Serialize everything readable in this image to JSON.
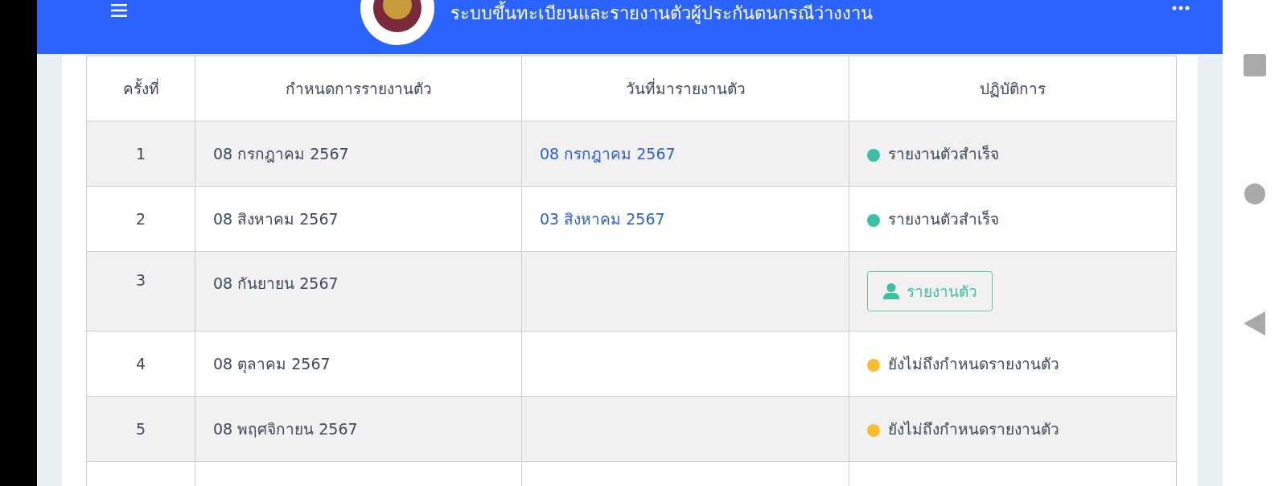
{
  "header": {
    "title": "ระบบขึ้นทะเบียนและรายงานตัวผู้ประกันตนกรณีว่างงาน"
  },
  "table": {
    "columns": [
      "ครั้งที่",
      "กำหนดการรายงานตัว",
      "วันที่มารายงานตัว",
      "ปฏิบัติการ"
    ],
    "rows": [
      {
        "number": "1",
        "due_date": "08 กรกฎาคม 2567",
        "report_date": "08 กรกฎาคม 2567",
        "action": {
          "kind": "status",
          "label": "รายงานตัวสำเร็จ",
          "color": "#3cbfa3"
        }
      },
      {
        "number": "2",
        "due_date": "08 สิงหาคม 2567",
        "report_date": "03 สิงหาคม 2567",
        "action": {
          "kind": "status",
          "label": "รายงานตัวสำเร็จ",
          "color": "#3cbfa3"
        }
      },
      {
        "number": "3",
        "due_date": "08 กันยายน 2567",
        "action": {
          "kind": "button",
          "label": "รายงานตัว"
        }
      },
      {
        "number": "4",
        "due_date": "08 ตุลาคม 2567",
        "action": {
          "kind": "status",
          "label": "ยังไม่ถึงกำหนดรายงานตัว",
          "color": "#fbbd2e"
        }
      },
      {
        "number": "5",
        "due_date": "08 พฤศจิกายน 2567",
        "action": {
          "kind": "status",
          "label": "ยังไม่ถึงกำหนดรายงานตัว",
          "color": "#fbbd2e"
        }
      },
      {
        "number": "",
        "due_date": ""
      }
    ]
  }
}
